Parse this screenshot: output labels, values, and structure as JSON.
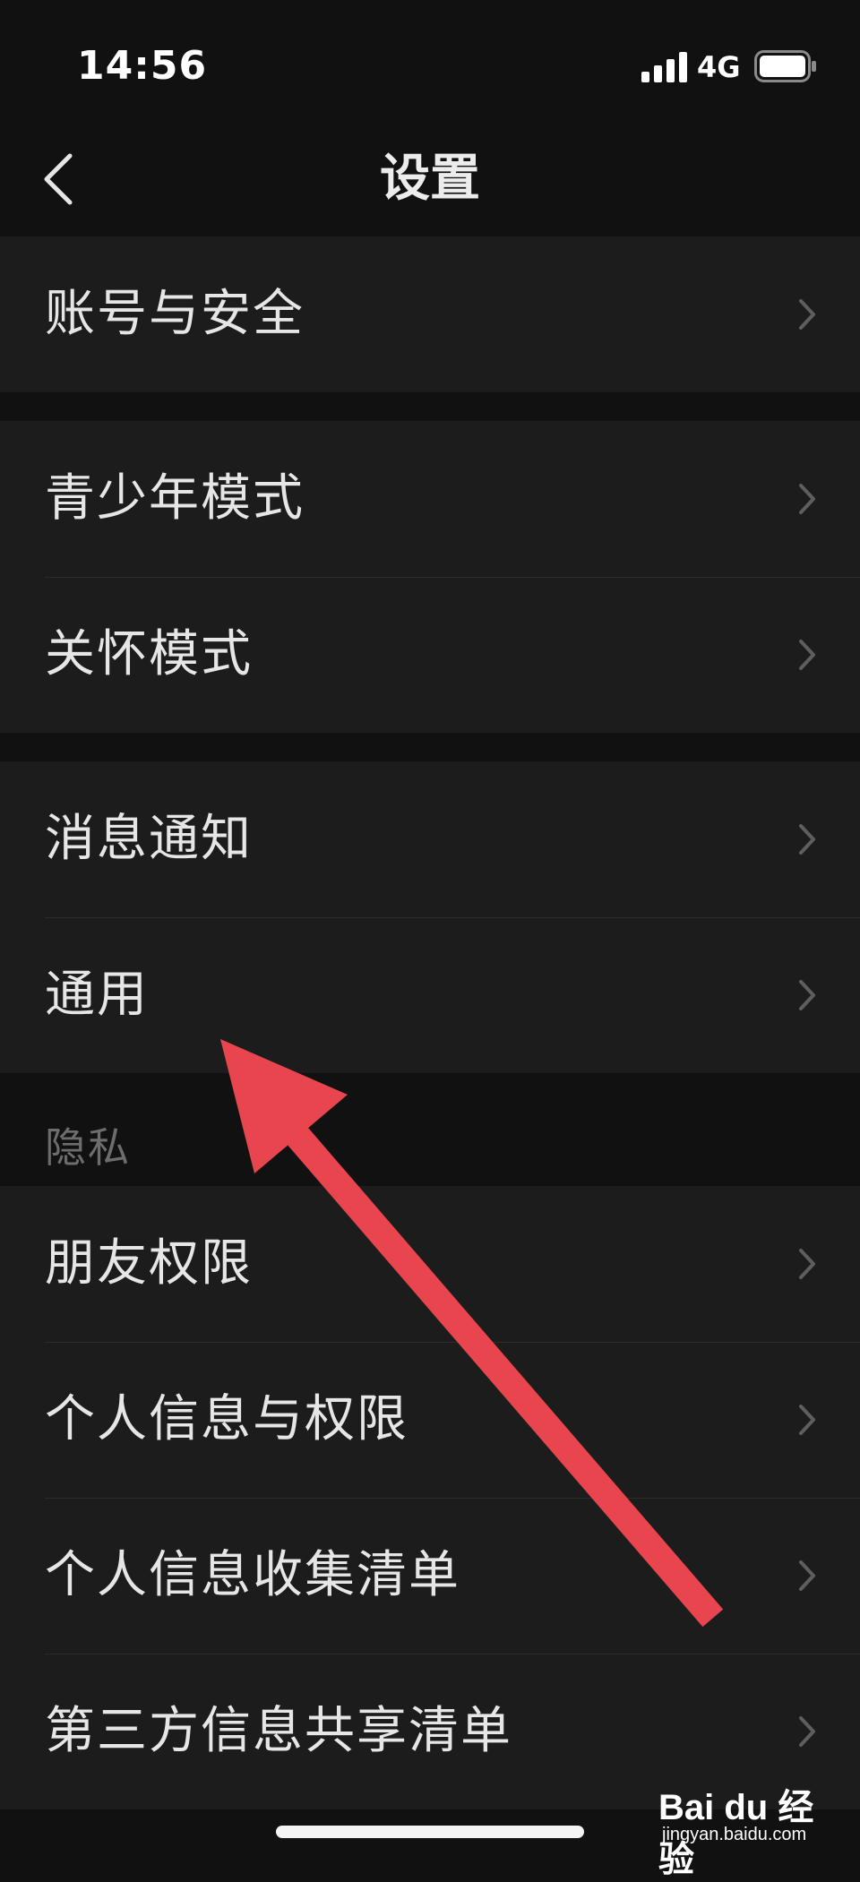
{
  "status_bar": {
    "time": "14:56",
    "network": "4G",
    "icons": [
      "signal-icon",
      "battery-icon"
    ]
  },
  "nav": {
    "title": "设置",
    "back_icon": "chevron-left-icon"
  },
  "groups": [
    {
      "items": [
        {
          "label": "账号与安全"
        }
      ]
    },
    {
      "items": [
        {
          "label": "青少年模式"
        },
        {
          "label": "关怀模式"
        }
      ]
    },
    {
      "items": [
        {
          "label": "消息通知"
        },
        {
          "label": "通用"
        }
      ]
    },
    {
      "header": "隐私",
      "items": [
        {
          "label": "朋友权限"
        },
        {
          "label": "个人信息与权限"
        },
        {
          "label": "个人信息收集清单"
        },
        {
          "label": "第三方信息共享清单"
        }
      ]
    }
  ],
  "watermark": {
    "brand": "Bai du 经验",
    "sub": "jingyan.baidu.com"
  },
  "colors": {
    "background": "#111111",
    "cell": "#1c1c1c",
    "text": "#e6e6e6",
    "secondary": "#6d6d6d",
    "annotation_arrow": "#e8454f"
  }
}
